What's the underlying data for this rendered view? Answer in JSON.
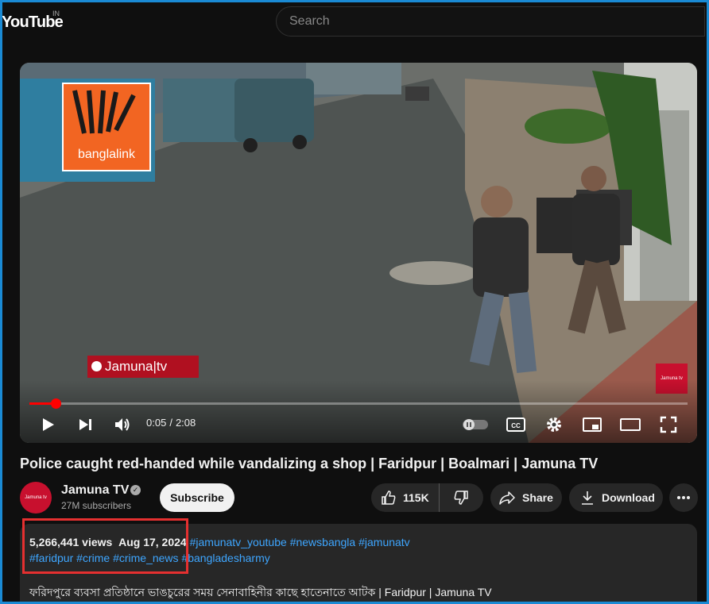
{
  "header": {
    "logo_text": "YouTube",
    "region_code": "IN",
    "search_placeholder": "Search"
  },
  "video": {
    "overlay_logo_text": "banglalink",
    "watermark_text": "Jamuna|tv",
    "corner_badge_text": "Jamuna tv",
    "progress_fraction": 0.04,
    "current_time": "0:05",
    "time_separator": "/",
    "duration": "2:08"
  },
  "title": "Police caught red-handed while vandalizing a shop | Faridpur | Boalmari | Jamuna TV",
  "channel": {
    "avatar_text": "Jamuna tv",
    "name": "Jamuna TV",
    "verified_mark": "✓",
    "subscribers": "27M subscribers",
    "subscribe_label": "Subscribe"
  },
  "actions": {
    "like_count": "115K",
    "share_label": "Share",
    "download_label": "Download"
  },
  "description": {
    "views": "5,266,441 views",
    "date": "Aug 17, 2024",
    "hashtags_line1": [
      "#jamunatv_youtube",
      "#newsbangla",
      "#jamunatv"
    ],
    "hashtags_line2": [
      "#faridpur",
      "#crime",
      "#crime_news",
      "#bangladesharmy"
    ],
    "text": "ফরিদপুরে ব্যবসা প্রতিষ্ঠানে ভাঙচুরের সময় সেনাবাহিনীর কাছে হাতেনাতে আটক | Faridpur | Jamuna TV"
  },
  "colors": {
    "accent_red": "#ff0000",
    "hashtag_blue": "#3ea6ff",
    "highlight_red": "#e53030",
    "frame_blue": "#1a8ad4"
  }
}
